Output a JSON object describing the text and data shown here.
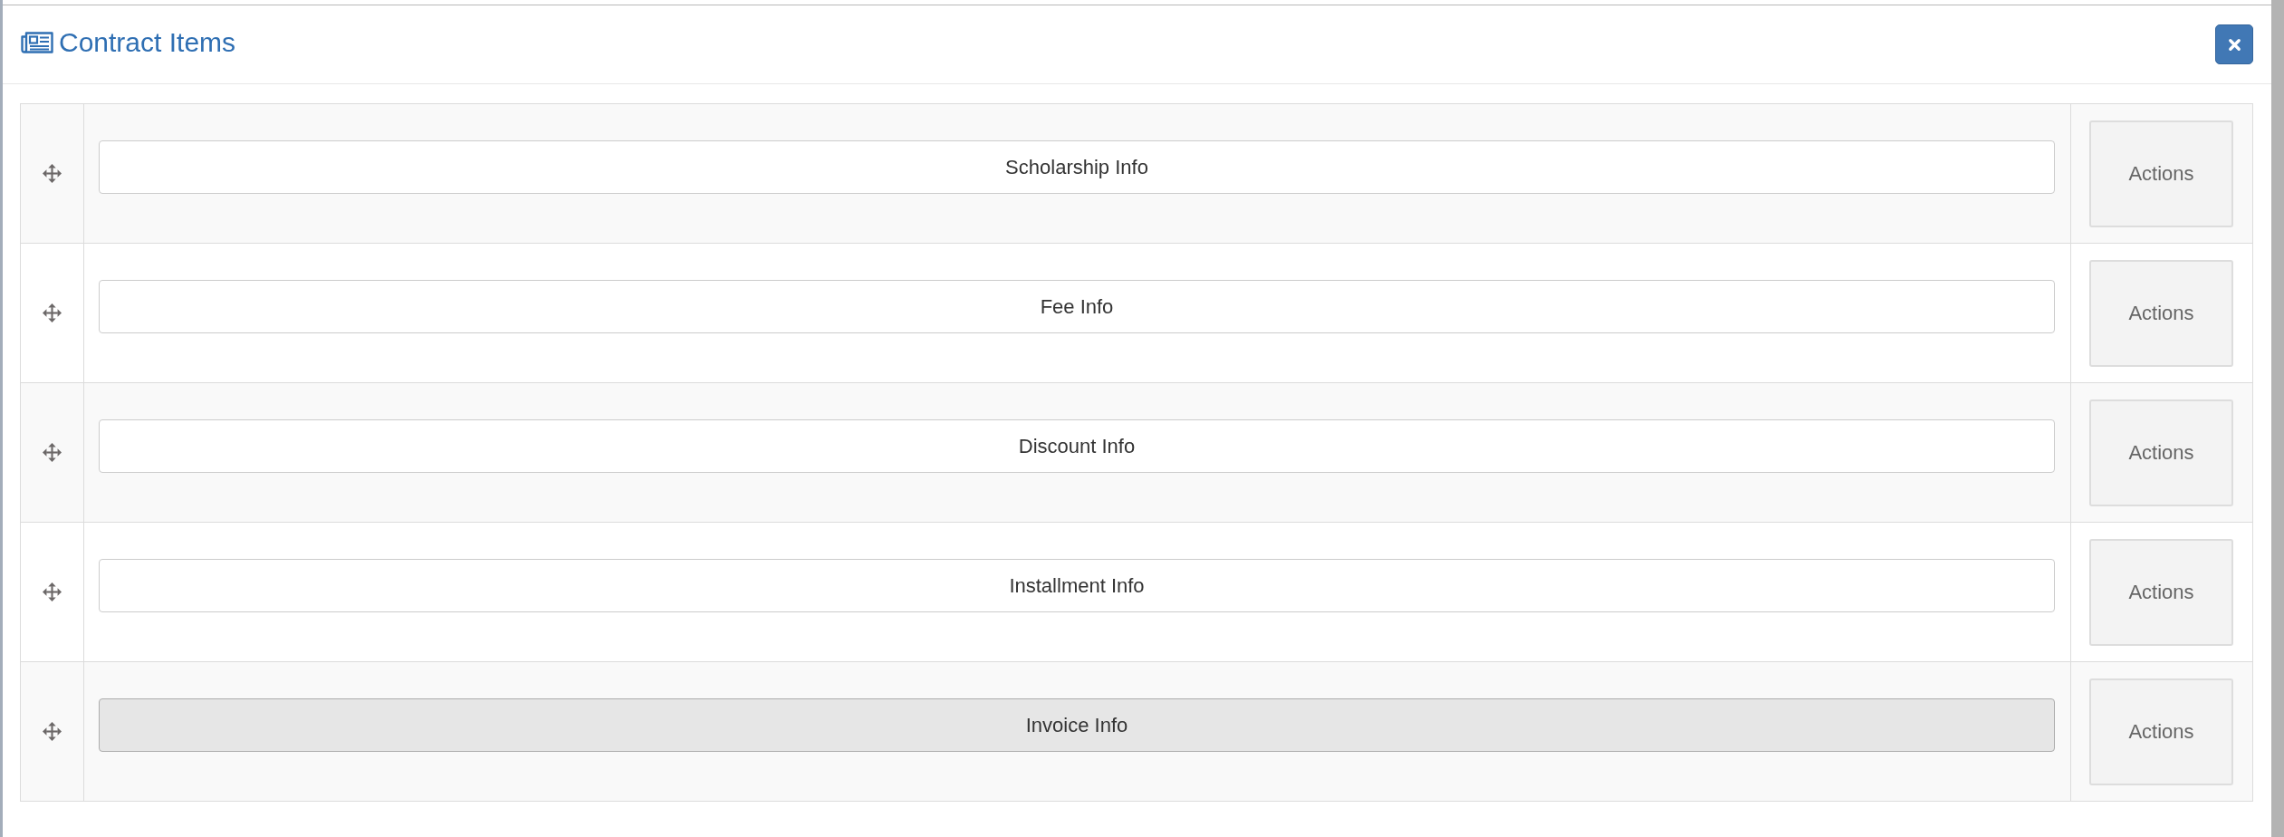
{
  "dialog": {
    "title": "Contract Items"
  },
  "items": [
    {
      "label": "Scholarship Info",
      "selected": false,
      "actions": "Actions"
    },
    {
      "label": "Fee Info",
      "selected": false,
      "actions": "Actions"
    },
    {
      "label": "Discount Info",
      "selected": false,
      "actions": "Actions"
    },
    {
      "label": "Installment Info",
      "selected": false,
      "actions": "Actions"
    },
    {
      "label": "Invoice Info",
      "selected": true,
      "actions": "Actions"
    }
  ]
}
